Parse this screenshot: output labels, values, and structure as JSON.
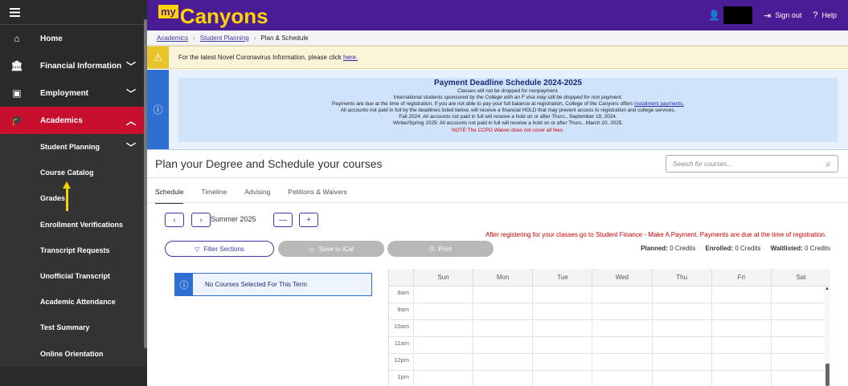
{
  "sidebar": {
    "items": [
      {
        "label": "Home",
        "icon": "home-icon",
        "glyph": "⌂"
      },
      {
        "label": "Financial Information",
        "icon": "bank-icon",
        "glyph": "🏛",
        "chevron": "﹀"
      },
      {
        "label": "Employment",
        "icon": "id-card-icon",
        "glyph": "▣",
        "chevron": "﹀"
      },
      {
        "label": "Academics",
        "icon": "graduation-cap-icon",
        "glyph": "🎓",
        "chevron": "︿"
      }
    ],
    "sub_items": [
      {
        "label": "Student Planning",
        "chevron": "﹀"
      },
      {
        "label": "Course Catalog"
      },
      {
        "label": "Grades"
      },
      {
        "label": "Enrollment Verifications"
      },
      {
        "label": "Transcript Requests"
      },
      {
        "label": "Unofficial Transcript"
      },
      {
        "label": "Academic Attendance"
      },
      {
        "label": "Test Summary"
      },
      {
        "label": "Online Orientation"
      }
    ],
    "active_color": "#c8102e"
  },
  "header": {
    "logo_my": "my",
    "logo_name": "Canyons",
    "sign_out": "Sign out",
    "help": "Help",
    "brand_color": "#4a1d96",
    "accent_color": "#ffd400"
  },
  "breadcrumb": [
    "Academics",
    "Student Planning",
    "Plan & Schedule"
  ],
  "covid_alert": {
    "text": "For the latest Novel Coronavirus Information, please click ",
    "link": "here."
  },
  "payment": {
    "title": "Payment Deadline Schedule 2024-2025",
    "line1": "Classes will not be dropped for nonpayment.",
    "line2a": "International students ",
    "line2b": "sponsored by the College with an F visa may still be dropped for non payment.",
    "line3a": "Payments are due at the time of registration. If you are not able to pay your full balance at registration, College of the Canyons offers ",
    "line3b": "installment payments.",
    "line4": "All accounts not paid in full by the deadlines listed below, will receive a financial HOLD that may prevent access to registration and college services.",
    "line5": "Fall 2024: All accounts not paid in full will receive a hold on or after Thurs., September 19, 2024.",
    "line6": "Winter/Spring 2025: All accounts not paid in full will receive a hold on or after Thurs., March 20, 2025.",
    "note": "NOTE:The CCPG Waiver does not cover all fees."
  },
  "main": {
    "title": "Plan your Degree and Schedule your courses",
    "search_placeholder": "Search for courses...",
    "tabs": [
      "Schedule",
      "Timeline",
      "Advising",
      "Petitions & Waivers"
    ],
    "term": "Summer 2025",
    "notice": "After registering for your classes go to Student Finance - Make A Payment. Payments are due at the time of registration.",
    "filter_label": "Filter Sections",
    "ical_label": "Save to iCal",
    "print_label": "Print",
    "credits": {
      "planned_label": "Planned:",
      "planned": "0 Credits",
      "enrolled_label": "Enrolled:",
      "enrolled": "0 Credits",
      "waitlisted_label": "Waitlisted:",
      "waitlisted": "0 Credits"
    },
    "no_courses": "No Courses Selected For This Term"
  },
  "calendar": {
    "days": [
      "Sun",
      "Mon",
      "Tue",
      "Wed",
      "Thu",
      "Fri",
      "Sat"
    ],
    "times": [
      "8am",
      "9am",
      "10am",
      "11am",
      "12pm",
      "1pm"
    ]
  }
}
